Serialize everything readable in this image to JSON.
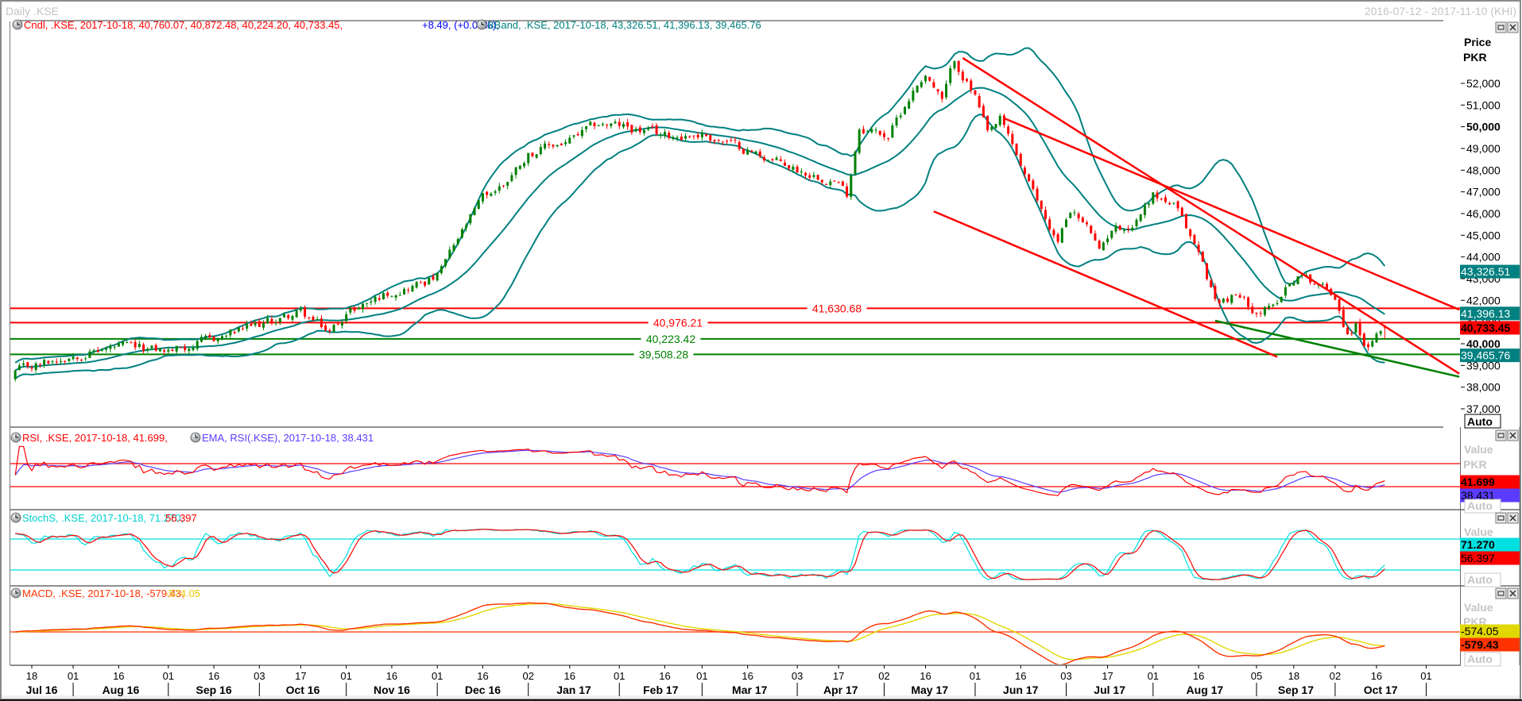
{
  "window": {
    "title": "Daily .KSE",
    "range": "2016-07-12 - 2017-11-10 (KHI)"
  },
  "legend": {
    "cndl_text": "Cndl, .KSE, 2017-10-18, 40,760.07, 40,872.48, 40,224.20, 40,733.45,",
    "cndl_change": "+8.49, (+0.02%),",
    "bband_text": "BBand, .KSE, 2017-10-18, 43,326.51, 41,396.13, 39,465.76",
    "rsi_text": "RSI, .KSE, 2017-10-18, 41.699,",
    "ema_text": "EMA, RSI(.KSE), 2017-10-18, 38.431",
    "stoch_text": "StochS, .KSE, 2017-10-18, 71.270,",
    "stoch_d": "56.397",
    "macd_text": "MACD, .KSE, 2017-10-18, -579.43,",
    "macd_signal": "-574.05"
  },
  "price_axis": {
    "title": "Price",
    "unit": "PKR",
    "auto": "Auto",
    "ticks": [
      {
        "label": "52,000",
        "value": 52000,
        "bold": false
      },
      {
        "label": "51,000",
        "value": 51000,
        "bold": false
      },
      {
        "label": "50,000",
        "value": 50000,
        "bold": true
      },
      {
        "label": "49,000",
        "value": 49000,
        "bold": false
      },
      {
        "label": "48,000",
        "value": 48000,
        "bold": false
      },
      {
        "label": "47,000",
        "value": 47000,
        "bold": false
      },
      {
        "label": "46,000",
        "value": 46000,
        "bold": false
      },
      {
        "label": "45,000",
        "value": 45000,
        "bold": false
      },
      {
        "label": "44,000",
        "value": 44000,
        "bold": false
      },
      {
        "label": "43,000",
        "value": 43000,
        "bold": false
      },
      {
        "label": "42,000",
        "value": 42000,
        "bold": false
      },
      {
        "label": "41,000",
        "value": 41000,
        "bold": false
      },
      {
        "label": "40,000",
        "value": 40000,
        "bold": true
      },
      {
        "label": "39,000",
        "value": 39000,
        "bold": false
      },
      {
        "label": "38,000",
        "value": 38000,
        "bold": false
      },
      {
        "label": "37,000",
        "value": 37000,
        "bold": false
      }
    ],
    "badges": [
      {
        "label": "43,326.51",
        "value": 43326.51,
        "bg": "#008080",
        "fg": "#ffffff",
        "bold": false
      },
      {
        "label": "41,396.13",
        "value": 41396.13,
        "bg": "#008080",
        "fg": "#ffffff",
        "bold": false
      },
      {
        "label": "40,733.45",
        "value": 40733.45,
        "bg": "#ff0000",
        "fg": "#000000",
        "bold": true
      },
      {
        "label": "39,465.76",
        "value": 39465.76,
        "bg": "#008080",
        "fg": "#ffffff",
        "bold": false
      }
    ]
  },
  "subpanes": {
    "rsi": {
      "axis_title": "Value",
      "unit": "PKR",
      "auto": "Auto",
      "badges": [
        {
          "label": "41.699",
          "bg": "#ff0000",
          "fg": "#000000",
          "bold": true
        },
        {
          "label": "38.431",
          "bg": "#5a3cff",
          "fg": "#000000",
          "bold": false
        }
      ]
    },
    "stoch": {
      "axis_title": "Value",
      "unit": "PKR",
      "auto": "Auto",
      "badges": [
        {
          "label": "71.270",
          "bg": "#00e0e0",
          "fg": "#000000",
          "bold": true
        },
        {
          "label": "56.397",
          "bg": "#ff0000",
          "fg": "#000000",
          "bold": false
        }
      ]
    },
    "macd": {
      "axis_title": "Value",
      "unit": "PKR",
      "auto": "Auto",
      "badges": [
        {
          "label": "-574.05",
          "bg": "#e0d800",
          "fg": "#000000",
          "bold": false
        },
        {
          "label": "-579.43",
          "bg": "#ff3300",
          "fg": "#000000",
          "bold": true
        }
      ]
    }
  },
  "colors": {
    "up": "#008000",
    "down": "#ff0000",
    "bband": "#008080",
    "rsi": "#ff0000",
    "ema": "#5a3cff",
    "stoch_k": "#00e0e0",
    "stoch_d": "#ff0000",
    "macd": "#ff3300",
    "signal": "#e0d800"
  },
  "chart_data": {
    "type": "candlestick",
    "symbol": ".KSE",
    "interval": "Daily",
    "ylabel": "Price PKR",
    "ylim": [
      36700,
      54900
    ],
    "close_keypoints": [
      [
        "2016-07-12",
        38700
      ],
      [
        "2016-07-25",
        39217
      ],
      [
        "2016-08-01",
        39530
      ],
      [
        "2016-08-16",
        39840
      ],
      [
        "2016-09-01",
        39660
      ],
      [
        "2016-09-16",
        40200
      ],
      [
        "2016-10-03",
        40870
      ],
      [
        "2016-10-17",
        41450
      ],
      [
        "2016-10-26",
        40510
      ],
      [
        "2016-11-01",
        41450
      ],
      [
        "2016-11-16",
        42430
      ],
      [
        "2016-11-25",
        42800
      ],
      [
        "2016-12-01",
        43100
      ],
      [
        "2016-12-09",
        45120
      ],
      [
        "2016-12-16",
        46680
      ],
      [
        "2016-12-23",
        47350
      ],
      [
        "2017-01-02",
        48780
      ],
      [
        "2017-01-16",
        49360
      ],
      [
        "2017-01-25",
        50120
      ],
      [
        "2017-02-01",
        50030
      ],
      [
        "2017-02-16",
        49585
      ],
      [
        "2017-03-01",
        49670
      ],
      [
        "2017-03-16",
        48915
      ],
      [
        "2017-04-03",
        48020
      ],
      [
        "2017-04-14",
        47570
      ],
      [
        "2017-04-19",
        46900
      ],
      [
        "2017-04-24",
        50030
      ],
      [
        "2017-05-03",
        49585
      ],
      [
        "2017-05-10",
        51370
      ],
      [
        "2017-05-16",
        52490
      ],
      [
        "2017-05-22",
        51150
      ],
      [
        "2017-05-25",
        53070
      ],
      [
        "2017-06-01",
        51370
      ],
      [
        "2017-06-06",
        49585
      ],
      [
        "2017-06-09",
        50255
      ],
      [
        "2017-06-14",
        49140
      ],
      [
        "2017-06-21",
        46900
      ],
      [
        "2017-06-29",
        44670
      ],
      [
        "2017-07-04",
        46230
      ],
      [
        "2017-07-11",
        45120
      ],
      [
        "2017-07-13",
        44130
      ],
      [
        "2017-07-18",
        45340
      ],
      [
        "2017-07-25",
        45470
      ],
      [
        "2017-08-01",
        46900
      ],
      [
        "2017-08-08",
        46370
      ],
      [
        "2017-08-16",
        44220
      ],
      [
        "2017-08-22",
        41990
      ],
      [
        "2017-08-29",
        42210
      ],
      [
        "2017-09-05",
        41540
      ],
      [
        "2017-09-11",
        41630
      ],
      [
        "2017-09-14",
        42660
      ],
      [
        "2017-09-19",
        43195
      ],
      [
        "2017-09-26",
        42790
      ],
      [
        "2017-10-02",
        42210
      ],
      [
        "2017-10-05",
        40420
      ],
      [
        "2017-10-09",
        40870
      ],
      [
        "2017-10-12",
        39750
      ],
      [
        "2017-10-16",
        40200
      ],
      [
        "2017-10-18",
        40733.45
      ]
    ],
    "last_candle": {
      "date": "2017-10-18",
      "open": 40760.07,
      "high": 40872.48,
      "low": 40224.2,
      "close": 40733.45
    },
    "horizontal_lines": [
      {
        "label": "41,630.68",
        "value": 41630.68,
        "color": "#ff0000"
      },
      {
        "label": "40,976.21",
        "value": 40976.21,
        "color": "#ff0000"
      },
      {
        "label": "40,223.42",
        "value": 40223.42,
        "color": "#008000"
      },
      {
        "label": "39,508.28",
        "value": 39508.28,
        "color": "#008000"
      }
    ],
    "trend_lines": [
      {
        "color": "#ff0000",
        "from": [
          "2017-06-12",
          50390
        ],
        "to": [
          "2017-11-13",
          41570
        ]
      },
      {
        "color": "#ff0000",
        "from": [
          "2017-05-29",
          53170
        ],
        "to": [
          "2017-11-13",
          38620
        ]
      },
      {
        "color": "#ff0000",
        "from": [
          "2017-05-18",
          46100
        ],
        "to": [
          "2017-09-12",
          39397
        ]
      },
      {
        "color": "#008000",
        "from": [
          "2017-08-22",
          41060
        ],
        "to": [
          "2017-11-13",
          38480
        ]
      }
    ],
    "rsi_levels": [
      70,
      30
    ],
    "stoch_levels": [
      80,
      20
    ],
    "macd_zero": 0,
    "x_ticks": [
      [
        "2016-07-18",
        "18"
      ],
      [
        "2016-08-01",
        "01"
      ],
      [
        "2016-08-16",
        "16"
      ],
      [
        "2016-09-01",
        "01"
      ],
      [
        "2016-09-16",
        "16"
      ],
      [
        "2016-10-03",
        "03"
      ],
      [
        "2016-10-17",
        "17"
      ],
      [
        "2016-11-01",
        "01"
      ],
      [
        "2016-11-16",
        "16"
      ],
      [
        "2016-12-01",
        "01"
      ],
      [
        "2016-12-16",
        "16"
      ],
      [
        "2017-01-02",
        "02"
      ],
      [
        "2017-01-16",
        "16"
      ],
      [
        "2017-02-01",
        "01"
      ],
      [
        "2017-02-16",
        "16"
      ],
      [
        "2017-03-01",
        "01"
      ],
      [
        "2017-03-16",
        "16"
      ],
      [
        "2017-04-03",
        "03"
      ],
      [
        "2017-04-17",
        "17"
      ],
      [
        "2017-05-02",
        "02"
      ],
      [
        "2017-05-16",
        "16"
      ],
      [
        "2017-06-01",
        "01"
      ],
      [
        "2017-06-16",
        "16"
      ],
      [
        "2017-07-03",
        "03"
      ],
      [
        "2017-07-17",
        "17"
      ],
      [
        "2017-08-01",
        "01"
      ],
      [
        "2017-08-16",
        "16"
      ],
      [
        "2017-09-05",
        "05"
      ],
      [
        "2017-09-18",
        "18"
      ],
      [
        "2017-10-02",
        "02"
      ],
      [
        "2017-10-16",
        "16"
      ],
      [
        "2017-11-01",
        "01"
      ]
    ],
    "months": [
      [
        "2016-07-01",
        "Jul 16"
      ],
      [
        "2016-08-01",
        "Aug 16"
      ],
      [
        "2016-09-01",
        "Sep 16"
      ],
      [
        "2016-10-03",
        "Oct 16"
      ],
      [
        "2016-11-01",
        "Nov 16"
      ],
      [
        "2016-12-01",
        "Dec 16"
      ],
      [
        "2017-01-02",
        "Jan 17"
      ],
      [
        "2017-02-01",
        "Feb 17"
      ],
      [
        "2017-03-01",
        "Mar 17"
      ],
      [
        "2017-04-03",
        "Apr 17"
      ],
      [
        "2017-05-02",
        "May 17"
      ],
      [
        "2017-06-01",
        "Jun 17"
      ],
      [
        "2017-07-03",
        "Jul 17"
      ],
      [
        "2017-08-01",
        "Aug 17"
      ],
      [
        "2017-09-05",
        "Sep 17"
      ],
      [
        "2017-10-02",
        "Oct 17"
      ],
      [
        "2017-11-01",
        ""
      ]
    ]
  }
}
